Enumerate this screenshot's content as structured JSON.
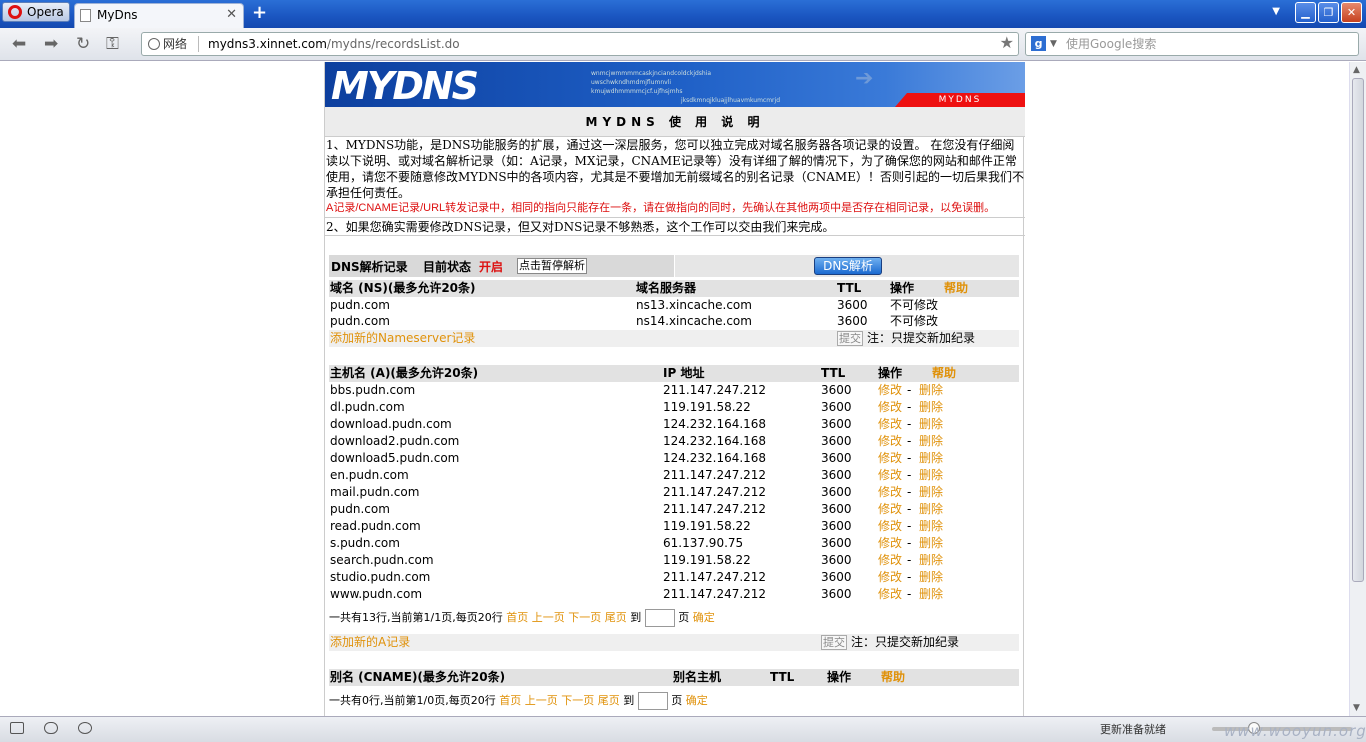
{
  "browser": {
    "app_button": "Opera",
    "tab_title": "MyDns",
    "url_security_label": "网络",
    "url_host": "mydns3.xinnet.com",
    "url_path": "/mydns/recordsList.do",
    "search_placeholder": "使用Google搜索",
    "status_text": "更新准备就绪",
    "watermark": "www.wooyun.org"
  },
  "banner": {
    "logo_text": "MYDNS",
    "tag_text": "MYDNS",
    "tiny_lines": [
      "wnmcjwmmmmcaskjnciandcoldckjdshia",
      "uwschwkndhmdmjflumnvli",
      "kmujwdhmmmmcjcf.ujfhsjmhs",
      "jksdkmnqjkluajjlhuavmkumcmrjd"
    ]
  },
  "manual": {
    "title": "MYDNS 使 用 说 明",
    "p1": "1、MYDNS功能，是DNS功能服务的扩展，通过这一深层服务，您可以独立完成对域名服务器各项记录的设置。 在您没有仔细阅读以下说明、或对域名解析记录（如：A记录，MX记录，CNAME记录等）没有详细了解的情况下，为了确保您的网站和邮件正常使用，请您不要随意修改MYDNS中的各项内容，尤其是不要增加无前缀域名的别名记录（CNAME）！否则引起的一切后果我们不承担任何责任。",
    "warning": "A记录/CNAME记录/URL转发记录中，相同的指向只能存在一条，请在做指向的同时，先确认在其他两项中是否存在相同记录，以免误删。",
    "p2": "2、如果您确实需要修改DNS记录，但又对DNS记录不够熟悉，这个工作可以交由我们来完成。"
  },
  "dns_status": {
    "label": "DNS解析记录",
    "state_label": "目前状态",
    "state_value": "开启",
    "pause_button": "点击暂停解析",
    "resolve_button": "DNS解析"
  },
  "ns_section": {
    "headers": {
      "domain": "域名 (NS)(最多允许20条)",
      "server": "域名服务器",
      "ttl": "TTL",
      "op": "操作",
      "help": "帮助"
    },
    "rows": [
      {
        "domain": "pudn.com",
        "server": "ns13.xincache.com",
        "ttl": "3600",
        "op": "不可修改"
      },
      {
        "domain": "pudn.com",
        "server": "ns14.xincache.com",
        "ttl": "3600",
        "op": "不可修改"
      }
    ],
    "add_link": "添加新的Nameserver记录",
    "submit": "提交",
    "note": "注：只提交新加纪录"
  },
  "a_section": {
    "headers": {
      "host": "主机名 (A)(最多允许20条)",
      "ip": "IP 地址",
      "ttl": "TTL",
      "op": "操作",
      "help": "帮助"
    },
    "edit": "修改",
    "sep": "-",
    "delete": "删除",
    "rows": [
      {
        "host": "bbs.pudn.com",
        "ip": "211.147.247.212",
        "ttl": "3600"
      },
      {
        "host": "dl.pudn.com",
        "ip": "119.191.58.22",
        "ttl": "3600"
      },
      {
        "host": "download.pudn.com",
        "ip": "124.232.164.168",
        "ttl": "3600"
      },
      {
        "host": "download2.pudn.com",
        "ip": "124.232.164.168",
        "ttl": "3600"
      },
      {
        "host": "download5.pudn.com",
        "ip": "124.232.164.168",
        "ttl": "3600"
      },
      {
        "host": "en.pudn.com",
        "ip": "211.147.247.212",
        "ttl": "3600"
      },
      {
        "host": "mail.pudn.com",
        "ip": "211.147.247.212",
        "ttl": "3600"
      },
      {
        "host": "pudn.com",
        "ip": "211.147.247.212",
        "ttl": "3600"
      },
      {
        "host": "read.pudn.com",
        "ip": "119.191.58.22",
        "ttl": "3600"
      },
      {
        "host": "s.pudn.com",
        "ip": "61.137.90.75",
        "ttl": "3600"
      },
      {
        "host": "search.pudn.com",
        "ip": "119.191.58.22",
        "ttl": "3600"
      },
      {
        "host": "studio.pudn.com",
        "ip": "211.147.247.212",
        "ttl": "3600"
      },
      {
        "host": "www.pudn.com",
        "ip": "211.147.247.212",
        "ttl": "3600"
      }
    ],
    "pager": {
      "summary": "一共有13行,当前第1/1页,每页20行",
      "first": "首页",
      "prev": "上一页",
      "next": "下一页",
      "last": "尾页",
      "goto": "到",
      "page": "页",
      "confirm": "确定"
    },
    "add_link": "添加新的A记录",
    "submit": "提交",
    "note": "注：只提交新加纪录"
  },
  "cname_section": {
    "headers": {
      "alias": "别名 (CNAME)(最多允许20条)",
      "target": "别名主机",
      "ttl": "TTL",
      "op": "操作",
      "help": "帮助"
    },
    "pager": {
      "summary": "一共有0行,当前第1/0页,每页20行",
      "first": "首页",
      "prev": "上一页",
      "next": "下一页",
      "last": "尾页",
      "goto": "到",
      "page": "页",
      "confirm": "确定"
    }
  }
}
